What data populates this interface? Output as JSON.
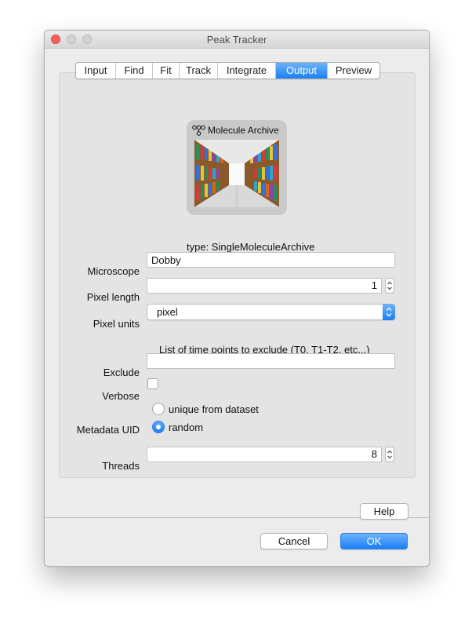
{
  "window": {
    "title": "Peak Tracker"
  },
  "tabs": [
    {
      "label": "Input",
      "active": false
    },
    {
      "label": "Find",
      "active": false
    },
    {
      "label": "Fit",
      "active": false
    },
    {
      "label": "Track",
      "active": false
    },
    {
      "label": "Integrate",
      "active": false
    },
    {
      "label": "Output",
      "active": true
    },
    {
      "label": "Preview",
      "active": false
    }
  ],
  "archive": {
    "header": "Molecule Archive",
    "icon": "molecule-icon",
    "image": "library-shelves-image",
    "type_text": "type: SingleMoleculeArchive"
  },
  "form": {
    "microscope": {
      "label": "Microscope",
      "value": "Dobby"
    },
    "pixel_length": {
      "label": "Pixel length",
      "value": "1"
    },
    "pixel_units": {
      "label": "Pixel units",
      "value": "pixel"
    },
    "exclude_hint": "List of time points to exclude (T0, T1-T2, etc...)",
    "exclude": {
      "label": "Exclude",
      "value": ""
    },
    "verbose": {
      "label": "Verbose",
      "checked": false
    },
    "metadata_uid": {
      "label": "Metadata UID",
      "options": [
        {
          "label": "unique from dataset",
          "selected": false
        },
        {
          "label": "random",
          "selected": true
        }
      ]
    },
    "threads": {
      "label": "Threads",
      "value": "8"
    }
  },
  "buttons": {
    "help": "Help",
    "cancel": "Cancel",
    "ok": "OK"
  },
  "colors": {
    "accent": "#1c7ff5",
    "close": "#fc605c",
    "window_bg": "#ececec"
  }
}
